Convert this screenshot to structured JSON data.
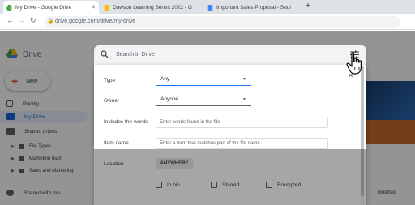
{
  "browser": {
    "tabs": [
      {
        "title": "My Drive - Google Drive",
        "active": true
      },
      {
        "title": "Dawson Learning Series 2022 - G",
        "active": false
      },
      {
        "title": "Important Sales Proposal - Sour",
        "active": false
      }
    ],
    "new_tab": "+",
    "url": "drive.google.com/drive/my-drive"
  },
  "drive": {
    "app_name": "Drive",
    "new_button": "New",
    "sidebar": {
      "priority": "Priority",
      "my_drive": "My Drive",
      "shared_drives": "Shared drives",
      "sub_items": [
        "File Types",
        "Marketing team",
        "Sales and Marketing"
      ],
      "shared_with_me": "Shared with me"
    },
    "column_modified": "modified"
  },
  "search": {
    "placeholder": "Search in Drive",
    "close": "✕",
    "type_label": "Type",
    "type_value": "Any",
    "owner_label": "Owner",
    "owner_value": "Anyone",
    "words_label": "Includes the words",
    "words_placeholder": "Enter words found in the file",
    "item_name_label": "Item name",
    "item_name_placeholder": "Enter a term that matches part of the file name",
    "location_label": "Location",
    "location_chip": "ANYWHERE",
    "checkboxes": [
      "In bin",
      "Starred",
      "Encrypted"
    ]
  },
  "colors": {
    "accent": "#1a73e8",
    "active_bg": "#e8f0fe"
  }
}
